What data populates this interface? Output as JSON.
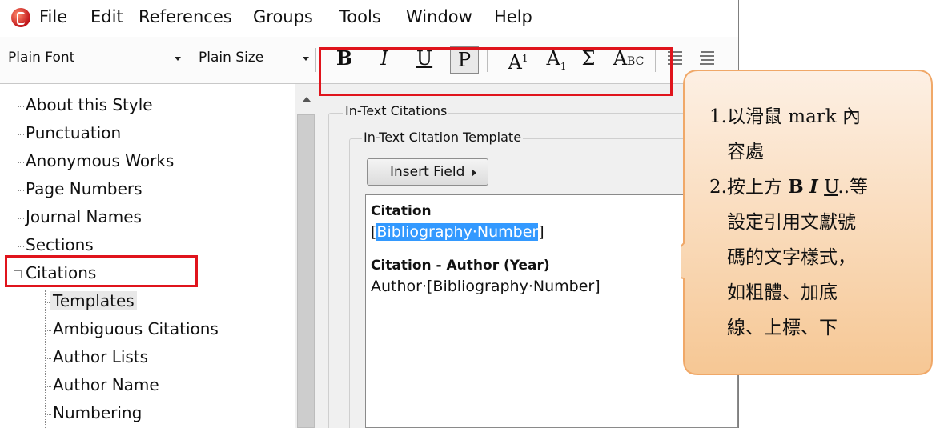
{
  "menu": {
    "items": [
      "File",
      "Edit",
      "References",
      "Groups",
      "Tools",
      "Window",
      "Help"
    ]
  },
  "toolbar": {
    "font_value": "Plain Font",
    "size_value": "Plain Size",
    "bold": "B",
    "italic": "I",
    "underline": "U",
    "plain": "P",
    "superscript_base": "A",
    "superscript_mark": "1",
    "subscript_base": "A",
    "subscript_mark": "1",
    "symbol": "Σ",
    "smallcaps_big": "A",
    "smallcaps_small": "BC"
  },
  "tree": {
    "items": [
      {
        "label": "About this Style"
      },
      {
        "label": "Punctuation"
      },
      {
        "label": "Anonymous Works"
      },
      {
        "label": "Page Numbers"
      },
      {
        "label": "Journal Names"
      },
      {
        "label": "Sections"
      },
      {
        "label": "Citations",
        "expanded": true
      },
      {
        "label": "Templates",
        "selected": true
      },
      {
        "label": "Ambiguous Citations"
      },
      {
        "label": "Author Lists"
      },
      {
        "label": "Author Name"
      },
      {
        "label": "Numbering"
      }
    ]
  },
  "panel": {
    "group_title": "In-Text Citations",
    "template_title": "In-Text Citation Template",
    "insert_field": "Insert Field",
    "citation_heading": "Citation",
    "citation_open": "[",
    "citation_selected": "Bibliography·Number",
    "citation_close": "]",
    "author_year_heading": "Citation - Author (Year)",
    "author_year_value": "Author·[Bibliography·Number]"
  },
  "callout": {
    "line1": "1.以滑鼠 mark 內",
    "line1b": "容處",
    "line2_pre": "2.按上方 ",
    "line2_b": "B",
    "line2_i": "I",
    "line2_u": "U",
    "line2_post": "..等",
    "line3": "設定引用文獻號",
    "line4": "碼的文字樣式，",
    "line5": "如粗體、加底",
    "line6": "線、上標、下",
    "fill_top": "#fdf0e4",
    "fill_bottom": "#f6c794",
    "stroke": "#f0a868"
  },
  "highlight_color": "#e0141c"
}
